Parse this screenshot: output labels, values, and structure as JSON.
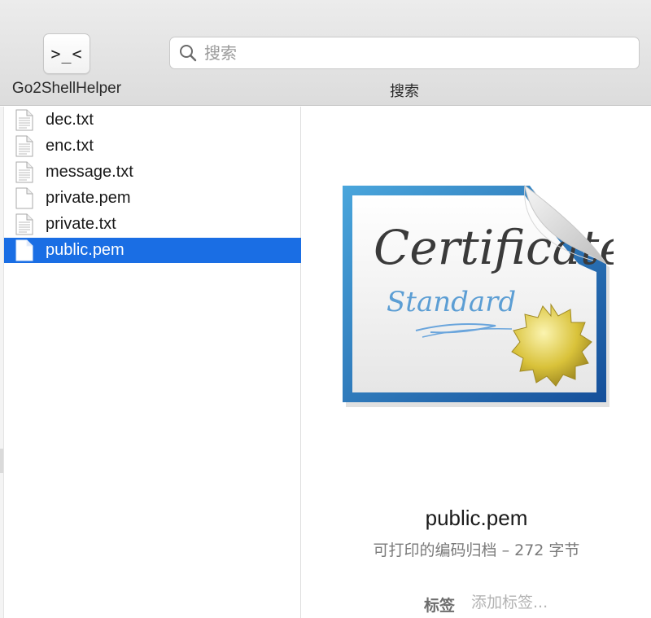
{
  "toolbar": {
    "app_button_glyph": ">_<",
    "app_label": "Go2ShellHelper",
    "search_placeholder": "搜索",
    "search_label": "搜索"
  },
  "files": [
    {
      "name": "dec.txt",
      "icon": "text-document-icon",
      "selected": false
    },
    {
      "name": "enc.txt",
      "icon": "text-document-icon",
      "selected": false
    },
    {
      "name": "message.txt",
      "icon": "text-document-icon",
      "selected": false
    },
    {
      "name": "private.pem",
      "icon": "blank-document-icon",
      "selected": false
    },
    {
      "name": "private.txt",
      "icon": "text-document-icon",
      "selected": false
    },
    {
      "name": "public.pem",
      "icon": "blank-document-icon",
      "selected": true
    }
  ],
  "preview": {
    "icon": "certificate-icon",
    "cert_title": "Certificate",
    "cert_subtitle": "Standard",
    "file_name": "public.pem",
    "kind": "可打印的编码归档 – 272 字节",
    "tags_label": "标签",
    "tags_placeholder": "添加标签..."
  },
  "colors": {
    "selection": "#1a6ee4",
    "cert_border": "#1e6fb8",
    "seal": "#d9c23a"
  }
}
